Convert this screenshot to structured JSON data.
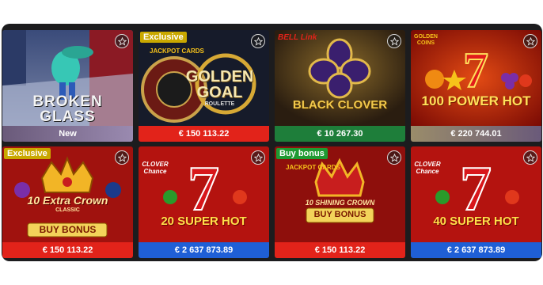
{
  "colors": {
    "bar_red": "#e2231a",
    "bar_green": "#1e7e3a",
    "bar_blue": "#1f5fd6",
    "badge_gold": "#c9a800",
    "badge_green": "#1f9a32",
    "jackpot_gold": "#f6c21a"
  },
  "games": [
    {
      "title_line1": "BROKEN",
      "title_line2": "GLASS",
      "label": "New",
      "badge": "",
      "bar": "grey"
    },
    {
      "title_line1": "GOLDEN",
      "title_line2": "GOAL",
      "sub": "ROULETTE",
      "label": "€ 150 113.22",
      "badge": "Exclusive",
      "bar": "red",
      "brand": "JACKPOT CARDS"
    },
    {
      "title_line1": "BLACK CLOVER",
      "label": "€ 10 267.30",
      "badge": "",
      "bar": "green",
      "brand": "BELL Link"
    },
    {
      "title_line1": "100 POWER HOT",
      "label": "€ 220 744.01",
      "badge": "",
      "bar": "mauve",
      "brand": "GOLDEN COINS"
    },
    {
      "title_line1": "10 Extra Crown",
      "sub": "CLASSIC",
      "title_line2": "BUY BONUS",
      "label": "€ 150 113.22",
      "badge": "Exclusive",
      "bar": "red"
    },
    {
      "title_line1": "20 SUPER HOT",
      "label": "€ 2 637 873.89",
      "badge": "",
      "bar": "blue",
      "brand": "CLOVER Chance"
    },
    {
      "title_line1": "10 SHINING CROWN",
      "title_line2": "BUY BONUS",
      "label": "€ 150 113.22",
      "badge": "Buy bonus",
      "bar": "red",
      "brand": "JACKPOT CARDS"
    },
    {
      "title_line1": "40 SUPER HOT",
      "label": "€ 2 637 873.89",
      "badge": "",
      "bar": "blue",
      "brand": "CLOVER Chance"
    }
  ]
}
